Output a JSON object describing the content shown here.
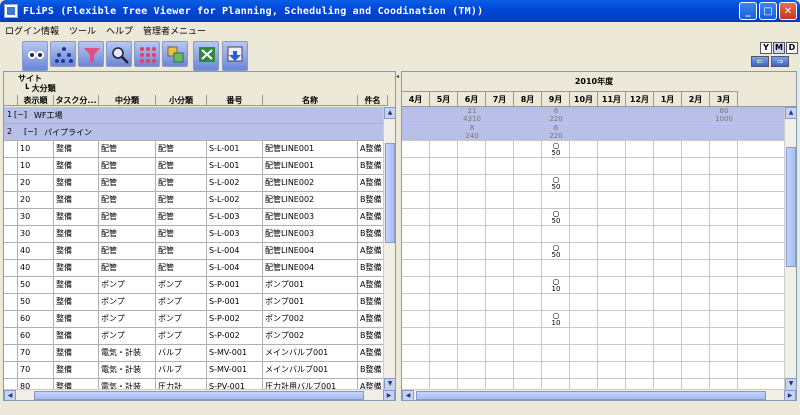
{
  "window": {
    "title": "FLiPS (Flexible Tree Viewer for Planning, Scheduling and Coodination (TM))"
  },
  "menu": [
    "ログイン情報",
    "ツール",
    "ヘルプ",
    "管理者メニュー"
  ],
  "side_buttons": {
    "y": "Y",
    "m": "M",
    "d": "D",
    "back": "⇐",
    "forward": "⇒"
  },
  "grid": {
    "header_top": "サイト",
    "header_mid": "大分類",
    "columns": [
      "表示順",
      "タスク分...",
      "中分類",
      "小分類",
      "番号",
      "名称",
      "件名"
    ],
    "groups": [
      {
        "num": "1",
        "toggle": "[−]",
        "label": "WF工場"
      },
      {
        "num": "2",
        "toggle": "[−]",
        "label": "パイプライン"
      }
    ],
    "rows": [
      [
        "10",
        "整備",
        "配管",
        "配管",
        "S-L-001",
        "配管LINE001",
        "A整備"
      ],
      [
        "10",
        "整備",
        "配管",
        "配管",
        "S-L-001",
        "配管LINE001",
        "B整備"
      ],
      [
        "20",
        "整備",
        "配管",
        "配管",
        "S-L-002",
        "配管LINE002",
        "A整備"
      ],
      [
        "20",
        "整備",
        "配管",
        "配管",
        "S-L-002",
        "配管LINE002",
        "B整備"
      ],
      [
        "30",
        "整備",
        "配管",
        "配管",
        "S-L-003",
        "配管LINE003",
        "A整備"
      ],
      [
        "30",
        "整備",
        "配管",
        "配管",
        "S-L-003",
        "配管LINE003",
        "B整備"
      ],
      [
        "40",
        "整備",
        "配管",
        "配管",
        "S-L-004",
        "配管LINE004",
        "A整備"
      ],
      [
        "40",
        "整備",
        "配管",
        "配管",
        "S-L-004",
        "配管LINE004",
        "B整備"
      ],
      [
        "50",
        "整備",
        "ポンプ",
        "ポンプ",
        "S-P-001",
        "ポンプ001",
        "A整備"
      ],
      [
        "50",
        "整備",
        "ポンプ",
        "ポンプ",
        "S-P-001",
        "ポンプ001",
        "B整備"
      ],
      [
        "60",
        "整備",
        "ポンプ",
        "ポンプ",
        "S-P-002",
        "ポンプ002",
        "A整備"
      ],
      [
        "60",
        "整備",
        "ポンプ",
        "ポンプ",
        "S-P-002",
        "ポンプ002",
        "B整備"
      ],
      [
        "70",
        "整備",
        "電気・計装",
        "バルブ",
        "S-MV-001",
        "メインバルブ001",
        "A整備"
      ],
      [
        "70",
        "整備",
        "電気・計装",
        "バルブ",
        "S-MV-001",
        "メインバルブ001",
        "B整備"
      ],
      [
        "80",
        "整備",
        "電気・計装",
        "圧力計",
        "S-PV-001",
        "圧力計用バルブ001",
        "A整備"
      ]
    ]
  },
  "gantt": {
    "year": "2010年度",
    "months": [
      "4月",
      "5月",
      "6月",
      "7月",
      "8月",
      "9月",
      "10月",
      "11月",
      "12月",
      "1月",
      "2月",
      "3月"
    ],
    "group1_marks": [
      {
        "month": 2,
        "lines": [
          "21",
          "4310"
        ]
      },
      {
        "month": 5,
        "lines": [
          "6",
          "220"
        ]
      },
      {
        "month": 11,
        "lines": [
          "80",
          "1000"
        ]
      }
    ],
    "group2_marks": [
      {
        "month": 2,
        "lines": [
          "8",
          "240"
        ]
      },
      {
        "month": 5,
        "lines": [
          "6",
          "220"
        ]
      }
    ],
    "row_marks": [
      {
        "row": 0,
        "month": 5,
        "symbol": "○",
        "value": "50"
      },
      {
        "row": 2,
        "month": 5,
        "symbol": "○",
        "value": "50"
      },
      {
        "row": 4,
        "month": 5,
        "symbol": "○",
        "value": "50"
      },
      {
        "row": 6,
        "month": 5,
        "symbol": "○",
        "value": "50"
      },
      {
        "row": 8,
        "month": 5,
        "symbol": "○",
        "value": "10"
      },
      {
        "row": 10,
        "month": 5,
        "symbol": "○",
        "value": "10"
      }
    ]
  }
}
